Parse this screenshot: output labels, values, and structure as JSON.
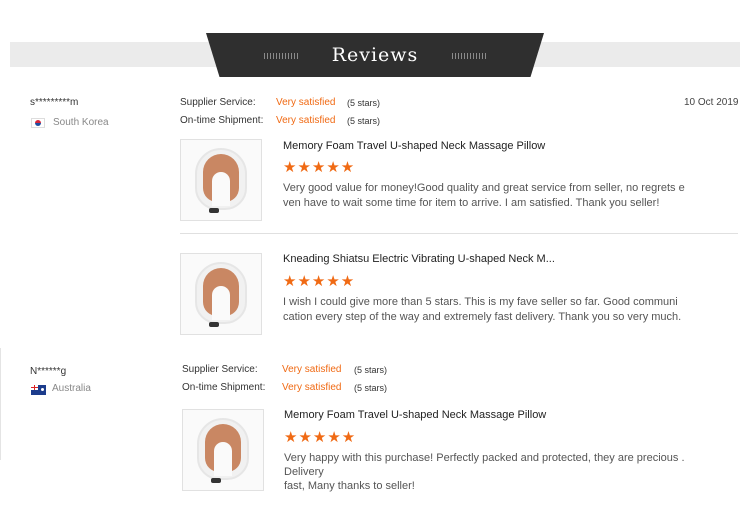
{
  "header": {
    "title": "Reviews"
  },
  "reviews": [
    {
      "reviewer": "s*********m",
      "country": "South Korea",
      "flag_icon": "south-korea-flag-icon",
      "supplier_label": "Supplier Service:",
      "supplier_value": "Very satisfied",
      "supplier_stars": "(5 stars)",
      "shipment_label": "On-time Shipment:",
      "shipment_value": "Very satisfied",
      "shipment_stars": "(5 stars)",
      "date": "10 Oct 2019",
      "items": [
        {
          "product": "Memory Foam Travel U-shaped Neck Massage Pillow",
          "rating": 5,
          "stars": "★★★★★",
          "text_line1": "Very good value for money!Good quality and great service from seller, no regrets e",
          "text_line2": "ven have to wait some time for item to arrive. I am satisfied. Thank you seller!"
        },
        {
          "product": "Kneading Shiatsu Electric Vibrating U-shaped Neck M...",
          "rating": 5,
          "stars": "★★★★★",
          "text_line1": "I wish I could give more than 5 stars. This is my fave seller so far. Good communi",
          "text_line2": "cation every step of the way and extremely fast delivery. Thank you so very much."
        }
      ]
    },
    {
      "reviewer": "N******g",
      "country": "Australia",
      "flag_icon": "australia-flag-icon",
      "supplier_label": "Supplier Service:",
      "supplier_value": "Very satisfied",
      "supplier_stars": "(5 stars)",
      "shipment_label": "On-time Shipment:",
      "shipment_value": "Very satisfied",
      "shipment_stars": "(5 stars)",
      "items": [
        {
          "product": "Memory Foam Travel U-shaped Neck Massage Pillow",
          "rating": 5,
          "stars": "★★★★★",
          "text_line1": "Very happy with this purchase! Perfectly packed and protected, they are precious .",
          "text_line2": "Delivery",
          "text_line3": "fast, Many thanks to seller!"
        }
      ]
    }
  ],
  "colors": {
    "accent": "#f06a14",
    "banner": "#2f2f2f",
    "strip": "#ebebeb"
  }
}
